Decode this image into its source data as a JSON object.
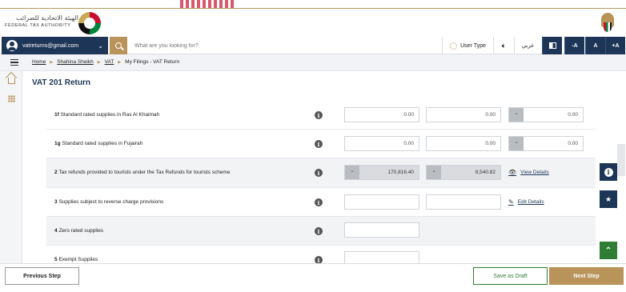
{
  "header": {
    "logo_arabic": "الهيئة الاتحادية للضرائب",
    "logo_english": "FEDERAL TAX AUTHORITY"
  },
  "searchbar": {
    "email": "vatreturns@gmail.com",
    "search_placeholder": "What are you looking for?",
    "user_type_label": "User Type",
    "language_label": "عربي",
    "font_decrease": "-A",
    "font_normal": "A",
    "font_increase": "+A"
  },
  "breadcrumb": {
    "items": [
      "Home",
      "Shahina Sheikh",
      "VAT",
      "My Filings - VAT Return"
    ]
  },
  "page": {
    "title": "VAT 201 Return"
  },
  "rows": [
    {
      "code": "1f",
      "label": "Standard rated supplies in Ras Al Khaimah",
      "amount": "0.00",
      "vat": "0.00",
      "adjustment": "0.00"
    },
    {
      "code": "1g",
      "label": "Standard rated supplies in Fujairah",
      "amount": "0.00",
      "vat": "0.00",
      "adjustment": "0.00"
    },
    {
      "code": "2",
      "label": "Tax refunds provided to tourists under the Tax Refunds for tourists scheme",
      "amount": "170,816.40",
      "vat": "8,540.82",
      "link": "View Details"
    },
    {
      "code": "3",
      "label": "Supplies subject to reverse charge provisions",
      "amount": "",
      "vat": "",
      "link": "Edit Details"
    },
    {
      "code": "4",
      "label": "Zero rated supplies",
      "amount": ""
    },
    {
      "code": "5",
      "label": "Exempt Supplies",
      "amount": ""
    }
  ],
  "dash": "-",
  "footer": {
    "previous": "Previous Step",
    "draft": "Save as Draft",
    "next": "Next Step"
  },
  "colors": {
    "navy": "#1d3557",
    "gold": "#b8935a",
    "green": "#2e7d32"
  }
}
